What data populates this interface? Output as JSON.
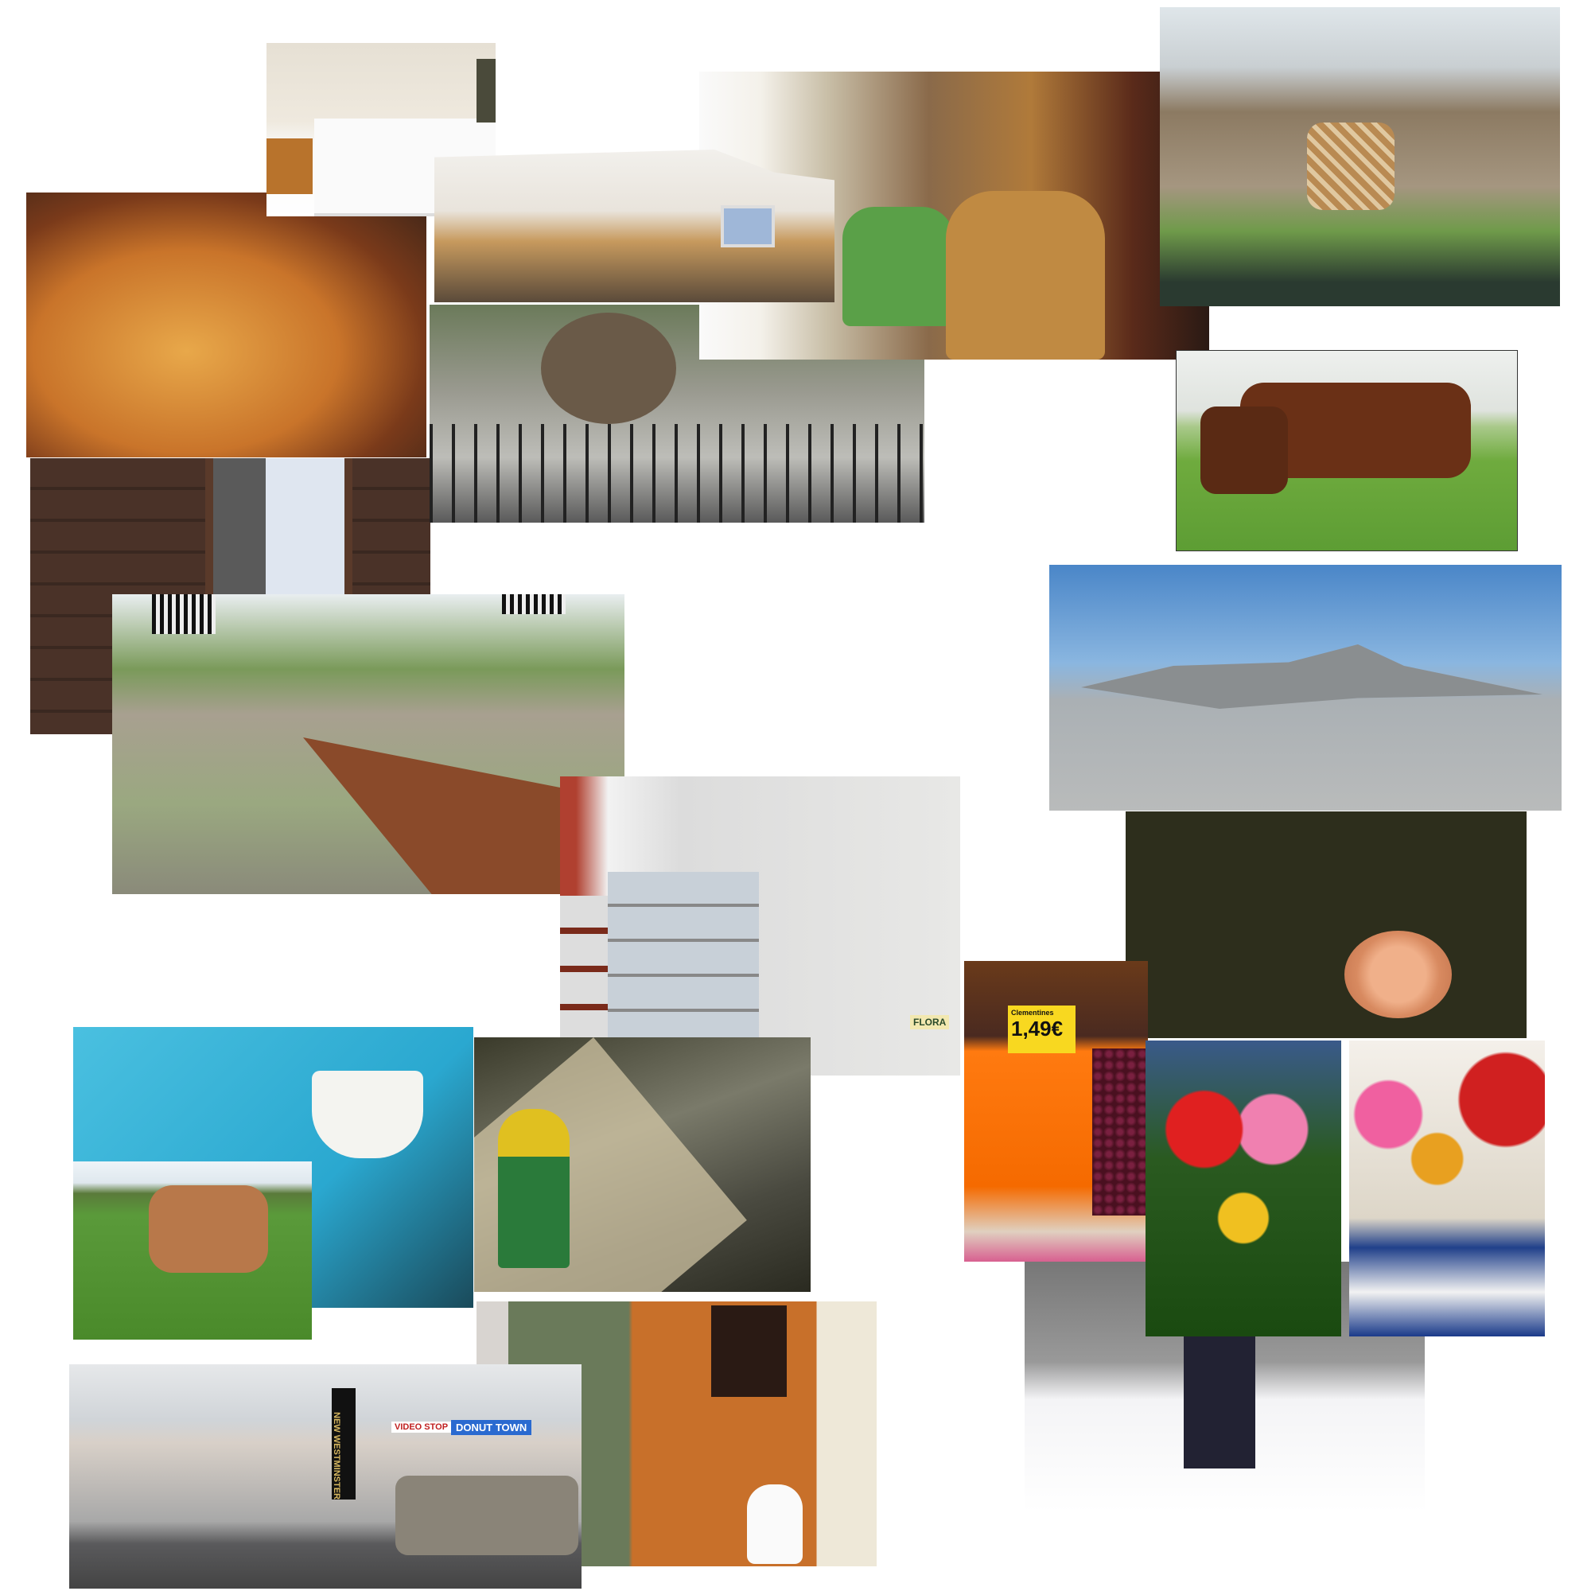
{
  "collage": {
    "street_sign": "NEW WESTMINSTER",
    "shop_sign_1": "VIDEO STOP",
    "shop_sign_2": "DONUT TOWN",
    "fruit_label": "Clementines",
    "fruit_price": "1,49€",
    "fridge_label": "FLORA"
  }
}
